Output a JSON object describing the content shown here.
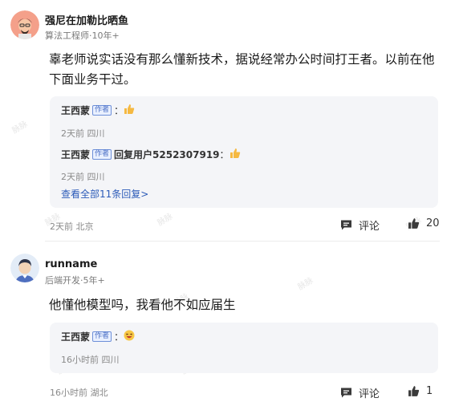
{
  "comments": [
    {
      "user_name": "强尼在加勒比晒鱼",
      "user_meta": "算法工程师·10年+",
      "text": "辜老师说实话没有那么懂新技术，据说经常办公时间打王者。以前在他下面业务干过。",
      "replies": [
        {
          "name": "王西蒙",
          "tag": "作者",
          "prefix": "",
          "suffix": "：",
          "emoji": "thumbs-up",
          "meta": "2天前 四川"
        },
        {
          "name": "王西蒙",
          "tag": "作者",
          "prefix": "回复用户5252307919",
          "suffix": "：",
          "emoji": "thumbs-up",
          "meta": "2天前 四川"
        }
      ],
      "view_all": "查看全部11条回复>",
      "footer_meta": "2天前 北京",
      "comment_label": "评论",
      "like_count": "20"
    },
    {
      "user_name": "runname",
      "user_meta": "后端开发·5年+",
      "text": "他懂他模型吗，我看他不如应届生",
      "replies": [
        {
          "name": "王西蒙",
          "tag": "作者",
          "prefix": "",
          "suffix": "：",
          "emoji": "laughing-face",
          "meta": "16小时前 四川"
        }
      ],
      "footer_meta": "16小时前 湖北",
      "comment_label": "评论",
      "like_count": "1"
    }
  ],
  "watermark": "脉脉",
  "colors": {
    "link": "#2c5bb8",
    "tag_border": "#6d8fd8",
    "reply_bg": "#f4f5f8",
    "thumb": "#f5b942"
  }
}
